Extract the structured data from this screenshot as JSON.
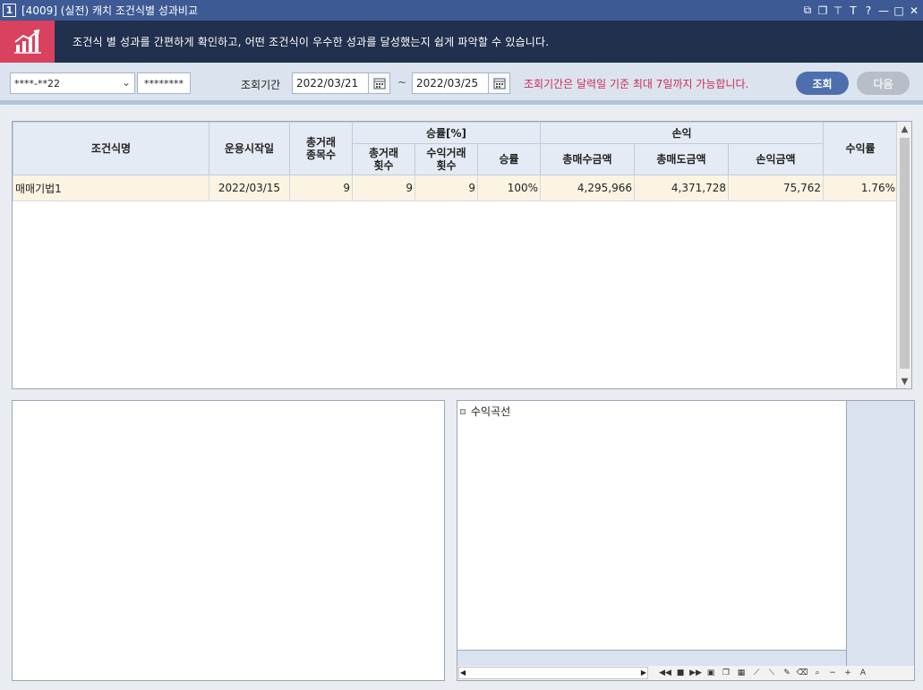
{
  "window": {
    "number": "1",
    "title": "[4009] (실전) 캐치 조건식별 성과비교"
  },
  "titlebar_icons": [
    "restore-icon",
    "copy-icon",
    "pin-icon",
    "font-icon",
    "help-icon",
    "minimize-icon",
    "maximize-icon",
    "close-icon"
  ],
  "titlebar_glyphs": {
    "font": "T",
    "help": "?",
    "minimize": "—",
    "maximize": "□",
    "close": "✕",
    "restore": "⧉",
    "copy": "❐",
    "pin": "⊤"
  },
  "banner": {
    "text": "조건식 별 성과를 간편하게 확인하고, 어떤 조건식이 우수한 성과를 달성했는지 쉽게 파악할 수 있습니다."
  },
  "filter": {
    "account": "****-**22",
    "password": "********",
    "period_label": "조회기간",
    "start_date": "2022/03/21",
    "tilde": "~",
    "end_date": "2022/03/25",
    "notice": "조회기간은 달력일 기준 최대 7일까지 가능합니다.",
    "query_button": "조회",
    "next_button": "다음"
  },
  "table": {
    "headers": {
      "name": "조건식명",
      "start": "운용시작일",
      "total_items_1": "총거래",
      "total_items_2": "종목수",
      "winrate_group": "승률[%]",
      "total_trades_1": "총거래",
      "total_trades_2": "횟수",
      "profit_trades_1": "수익거래",
      "profit_trades_2": "횟수",
      "winrate": "승률",
      "pnl_group": "손익",
      "buy_amount": "총매수금액",
      "sell_amount": "총매도금액",
      "pnl_amount": "손익금액",
      "return_rate": "수익률"
    },
    "rows": [
      {
        "name": "매매기법1",
        "start": "2022/03/15",
        "total_items": "9",
        "total_trades": "9",
        "profit_trades": "9",
        "winrate": "100%",
        "buy_amount": "4,295,966",
        "sell_amount": "4,371,728",
        "pnl_amount": "75,762",
        "return_rate": "1.76%"
      }
    ]
  },
  "chart": {
    "legend": "수익곡선",
    "font_button": "A"
  }
}
